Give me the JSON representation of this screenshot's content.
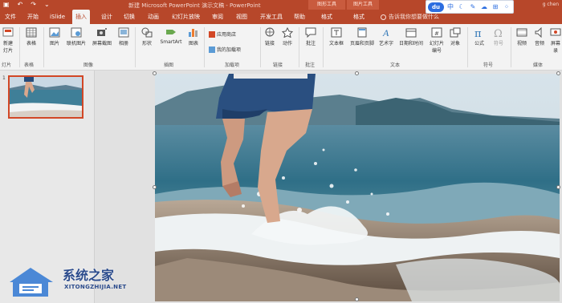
{
  "titlebar": {
    "title": "新建 Microsoft PowerPoint 演示文稿 - PowerPoint",
    "ctx1": "图形工具",
    "ctx2": "图片工具",
    "user": "g chen"
  },
  "tabs": [
    {
      "label": "文件"
    },
    {
      "label": "开始"
    },
    {
      "label": "iSlide"
    },
    {
      "label": "插入"
    },
    {
      "label": "设计"
    },
    {
      "label": "切换"
    },
    {
      "label": "动画"
    },
    {
      "label": "幻灯片放映"
    },
    {
      "label": "审阅"
    },
    {
      "label": "视图"
    },
    {
      "label": "开发工具"
    },
    {
      "label": "帮助"
    },
    {
      "label": "格式"
    },
    {
      "label": "格式"
    }
  ],
  "tell_me": "告诉我你想要做什么",
  "floatbar": {
    "logo": "du",
    "lang": "中"
  },
  "ribbon": {
    "new_slide": "新建\n灯片",
    "table": "表格",
    "picture": "图片",
    "online_picture": "联机图片",
    "screenshot": "屏幕截图",
    "album": "相册",
    "shapes": "形状",
    "smartart": "SmartArt",
    "chart": "图表",
    "store": "应用商店",
    "my_addins": "我的加载项",
    "link": "链接",
    "action": "动作",
    "comment": "批注",
    "textbox": "文本框",
    "header_footer": "页眉和页脚",
    "wordart": "艺术字",
    "datetime": "日期和时间",
    "slide_number": "幻灯片\n编号",
    "object": "对象",
    "equation": "公式",
    "symbol": "符号",
    "video": "视频",
    "audio": "音频",
    "screen_rec": "屏幕\n录",
    "groups": {
      "slides": "灯片",
      "tables": "表格",
      "images": "图像",
      "illustrations": "插图",
      "addins": "加载项",
      "links": "链接",
      "comments": "批注",
      "text": "文本",
      "symbols": "符号",
      "media": "媒体"
    }
  },
  "thumbnail": {
    "number": "1"
  },
  "watermark": {
    "name": "系统之家",
    "url": "XITONGZHIJIA.NET"
  }
}
